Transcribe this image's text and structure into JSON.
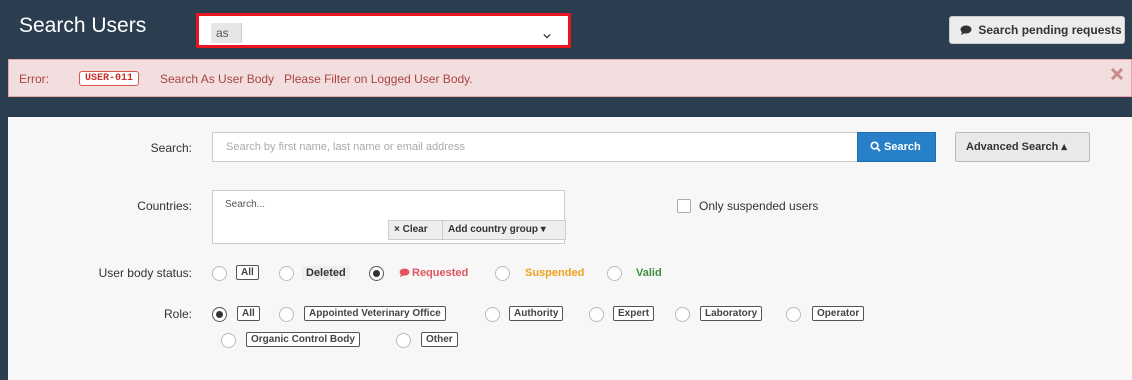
{
  "header": {
    "title": "Search Users",
    "as_prefix": "as",
    "pending_button": "Search pending requests"
  },
  "alert": {
    "label": "Error:",
    "code": "USER-011",
    "message": "Search As User Body   Please Filter on Logged User Body."
  },
  "search": {
    "label": "Search:",
    "placeholder": "Search by first name, last name or email address",
    "button": "Search",
    "advanced_button": "Advanced Search ▴"
  },
  "countries": {
    "label": "Countries:",
    "placeholder": "Search...",
    "clear_button": "× Clear",
    "group_button": "Add country group ▾"
  },
  "suspended_checkbox": {
    "label": "Only suspended users",
    "checked": false
  },
  "status": {
    "label": "User body status:",
    "options": [
      {
        "label": "All",
        "selected": false
      },
      {
        "label": "Deleted",
        "selected": false
      },
      {
        "label": "Requested",
        "selected": true
      },
      {
        "label": "Suspended",
        "selected": false
      },
      {
        "label": "Valid",
        "selected": false
      }
    ]
  },
  "role": {
    "label": "Role:",
    "options": [
      {
        "label": "All",
        "selected": true
      },
      {
        "label": "Appointed Veterinary Office",
        "selected": false
      },
      {
        "label": "Authority",
        "selected": false
      },
      {
        "label": "Expert",
        "selected": false
      },
      {
        "label": "Laboratory",
        "selected": false
      },
      {
        "label": "Operator",
        "selected": false
      },
      {
        "label": "Organic Control Body",
        "selected": false
      },
      {
        "label": "Other",
        "selected": false
      }
    ]
  },
  "colors": {
    "header_bg": "#2b3e50",
    "alert_bg": "#f2dede",
    "primary": "#2780c8",
    "highlight": "#e8141f"
  }
}
